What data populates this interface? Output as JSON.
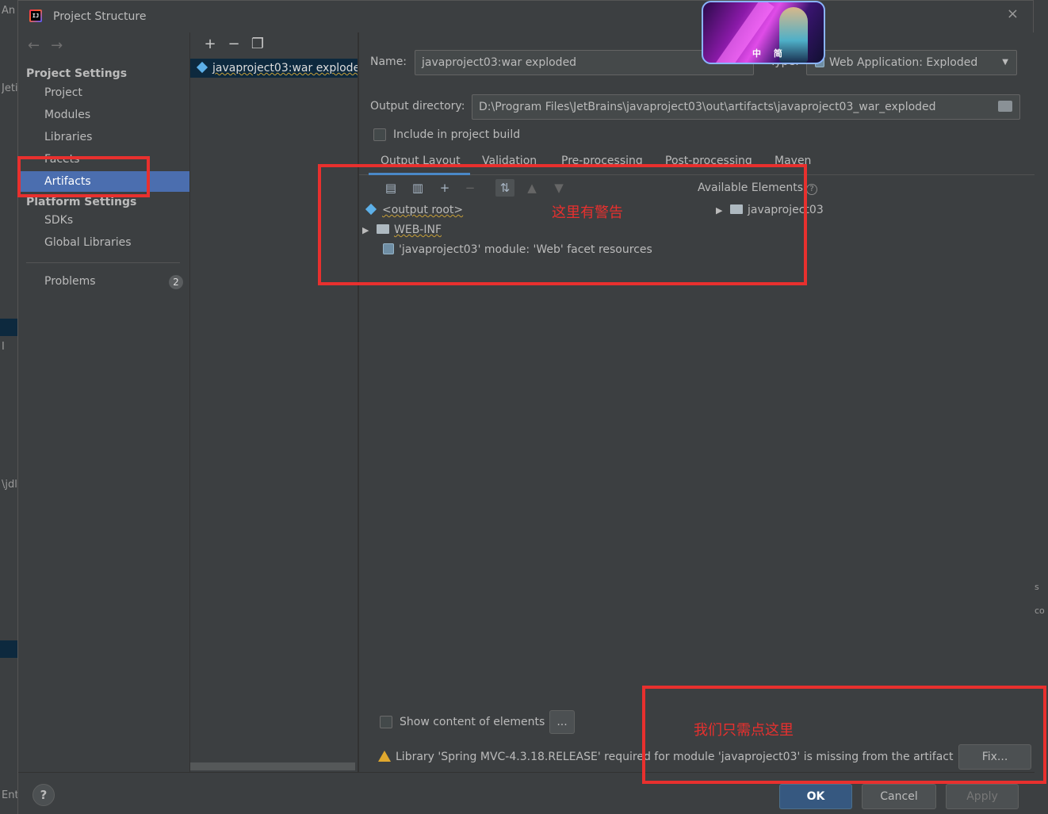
{
  "background": {
    "left_fragments": [
      "An",
      "Jeti",
      "I",
      "\\jdl",
      "Ent"
    ],
    "right_fragments": [
      "s",
      "co"
    ]
  },
  "dialog": {
    "title": "Project Structure",
    "close_glyph": "×",
    "avatar_caption": "中 简"
  },
  "nav": {
    "back": "←",
    "forward": "→",
    "project_settings": "Project Settings",
    "items_project": [
      "Project",
      "Modules",
      "Libraries",
      "Facets",
      "Artifacts"
    ],
    "selected": "Artifacts",
    "platform_settings": "Platform Settings",
    "items_platform": [
      "SDKs",
      "Global Libraries"
    ],
    "problems": "Problems",
    "problems_count": "2"
  },
  "list": {
    "toolbar": [
      "+",
      "−",
      "❐"
    ],
    "artifact": "javaproject03:war exploded"
  },
  "form": {
    "name_label": "Name:",
    "name_value": "javaproject03:war exploded",
    "type_label": "Type:",
    "type_value": "Web Application: Exploded",
    "output_label": "Output directory:",
    "output_value": "D:\\Program Files\\JetBrains\\javaproject03\\out\\artifacts\\javaproject03_war_exploded",
    "include_label": "Include in project build"
  },
  "tabs": [
    "Output Layout",
    "Validation",
    "Pre-processing",
    "Post-processing",
    "Maven"
  ],
  "layout": {
    "available_label": "Available Elements",
    "tree": {
      "output_root": "<output root>",
      "web_inf": "WEB-INF",
      "facet_resources": "'javaproject03' module: 'Web' facet resources"
    },
    "available_item": "javaproject03"
  },
  "bottom": {
    "show_content_label": "Show content of elements",
    "ellipsis": "...",
    "warning": "Library 'Spring MVC-4.3.18.RELEASE' required for module 'javaproject03' is missing from the artifact",
    "fix": "Fix..."
  },
  "footer": {
    "help": "?",
    "ok": "OK",
    "cancel": "Cancel",
    "apply": "Apply"
  },
  "annotations": {
    "warning_note": "这里有警告",
    "click_note": "我们只需点这里"
  },
  "colors": {
    "accent": "#4b6eaf",
    "annotation": "#e8302e",
    "warning": "#e0a82e"
  }
}
